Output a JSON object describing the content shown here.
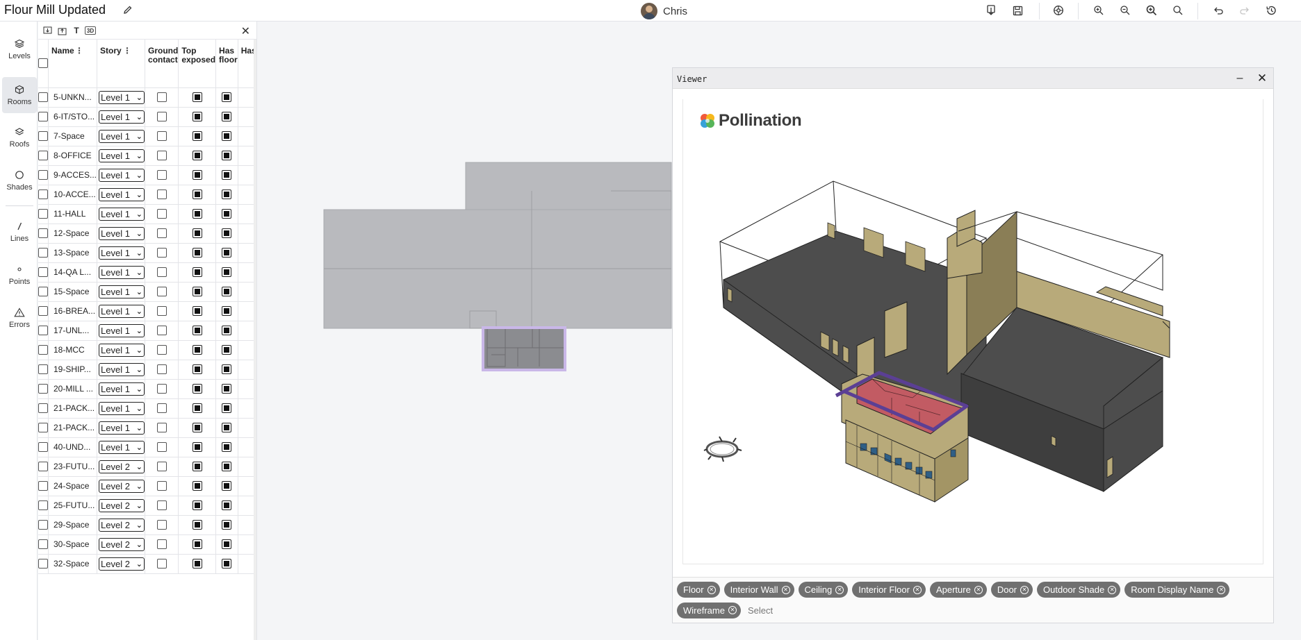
{
  "app": {
    "title": "Flour Mill Updated",
    "user_name": "Chris"
  },
  "toolbar": {
    "icons": [
      "import-icon",
      "save-icon",
      "settings-icon",
      "zoom-in-icon",
      "zoom-out-icon",
      "zoom-fit-icon",
      "zoom-selection-icon",
      "undo-icon",
      "redo-icon",
      "history-icon"
    ]
  },
  "nav": {
    "items": [
      {
        "label": "Levels",
        "icon": "layers-icon"
      },
      {
        "label": "Rooms",
        "icon": "cube-icon"
      },
      {
        "label": "Roofs",
        "icon": "roof-icon"
      },
      {
        "label": "Shades",
        "icon": "circle-icon"
      },
      {
        "label": "Lines",
        "icon": "line-icon"
      },
      {
        "label": "Points",
        "icon": "point-icon"
      },
      {
        "label": "Errors",
        "icon": "warning-icon"
      }
    ],
    "active": "Rooms"
  },
  "panel": {
    "tool_3d": "3D",
    "columns": [
      "Name",
      "Story",
      "Ground contact",
      "Top exposed",
      "Has floor",
      "Has ceiling"
    ],
    "rows": [
      {
        "name": "5-UNKN...",
        "story": "Level 1"
      },
      {
        "name": "6-IT/STO...",
        "story": "Level 1"
      },
      {
        "name": "7-Space",
        "story": "Level 1"
      },
      {
        "name": "8-OFFICE",
        "story": "Level 1"
      },
      {
        "name": "9-ACCES...",
        "story": "Level 1"
      },
      {
        "name": "10-ACCE...",
        "story": "Level 1"
      },
      {
        "name": "11-HALL",
        "story": "Level 1"
      },
      {
        "name": "12-Space",
        "story": "Level 1"
      },
      {
        "name": "13-Space",
        "story": "Level 1"
      },
      {
        "name": "14-QA L...",
        "story": "Level 1"
      },
      {
        "name": "15-Space",
        "story": "Level 1"
      },
      {
        "name": "16-BREA...",
        "story": "Level 1"
      },
      {
        "name": "17-UNL...",
        "story": "Level 1"
      },
      {
        "name": "18-MCC",
        "story": "Level 1"
      },
      {
        "name": "19-SHIP...",
        "story": "Level 1"
      },
      {
        "name": "20-MILL ...",
        "story": "Level 1"
      },
      {
        "name": "21-PACK...",
        "story": "Level 1"
      },
      {
        "name": "21-PACK...",
        "story": "Level 1"
      },
      {
        "name": "40-UND...",
        "story": "Level 1"
      },
      {
        "name": "23-FUTU...",
        "story": "Level 2"
      },
      {
        "name": "24-Space",
        "story": "Level 2"
      },
      {
        "name": "25-FUTU...",
        "story": "Level 2"
      },
      {
        "name": "29-Space",
        "story": "Level 2"
      },
      {
        "name": "30-Space",
        "story": "Level 2"
      },
      {
        "name": "32-Space",
        "story": "Level 2"
      }
    ]
  },
  "viewer": {
    "title": "Viewer",
    "logo_text": "Pollination",
    "chips": [
      "Floor",
      "Interior Wall",
      "Ceiling",
      "Interior Floor",
      "Aperture",
      "Door",
      "Outdoor Shade",
      "Room Display Name",
      "Wireframe"
    ],
    "select_placeholder": "Select"
  },
  "colors": {
    "wall_tan": "#b8aa7a",
    "floor_dark": "#4a4a4a",
    "selected_room": "#c25b63",
    "selection_outline": "#5b3f94",
    "plan_gray": "#b8b9bd"
  }
}
